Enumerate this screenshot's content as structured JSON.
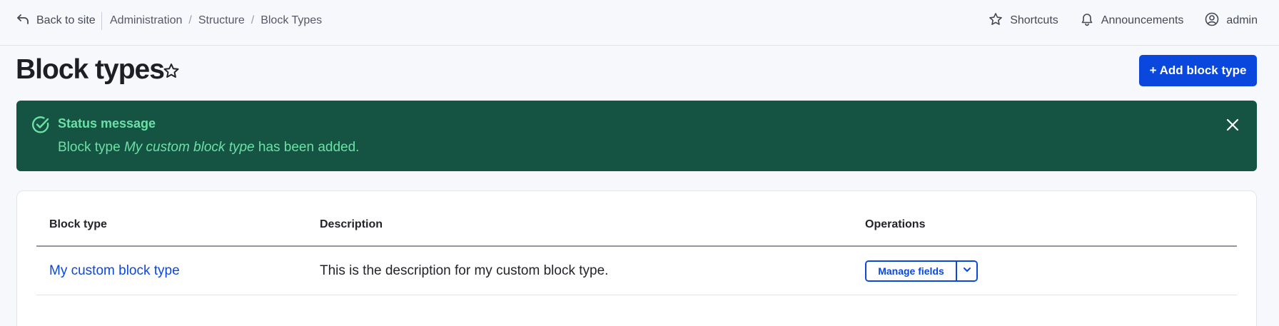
{
  "topbar": {
    "back_label": "Back to site",
    "breadcrumb": [
      "Administration",
      "Structure",
      "Block Types"
    ],
    "breadcrumb_separator": "/",
    "shortcuts_label": "Shortcuts",
    "announcements_label": "Announcements",
    "user_label": "admin"
  },
  "page": {
    "title": "Block types",
    "add_button_label": "+ Add block type"
  },
  "status": {
    "title": "Status message",
    "body_prefix": "Block type ",
    "body_emphasis": "My custom block type",
    "body_suffix": " has been added."
  },
  "table": {
    "headers": [
      "Block type",
      "Description",
      "Operations"
    ],
    "rows": [
      {
        "type": "My custom block type",
        "description": "This is the description for my custom block type.",
        "operation": "Manage fields"
      }
    ]
  },
  "colors": {
    "accent": "#0a48dd",
    "status_bg": "#155343",
    "status_text": "#6ce0a6",
    "page_bg": "#f7f8fb"
  },
  "icons": {
    "back": "arrow-back-icon",
    "shortcuts": "star-icon",
    "announcements": "bell-icon",
    "user": "user-circle-icon",
    "title_star": "star-outline-icon",
    "status": "check-circle-icon",
    "close": "close-icon",
    "dropdown": "chevron-down-icon"
  }
}
